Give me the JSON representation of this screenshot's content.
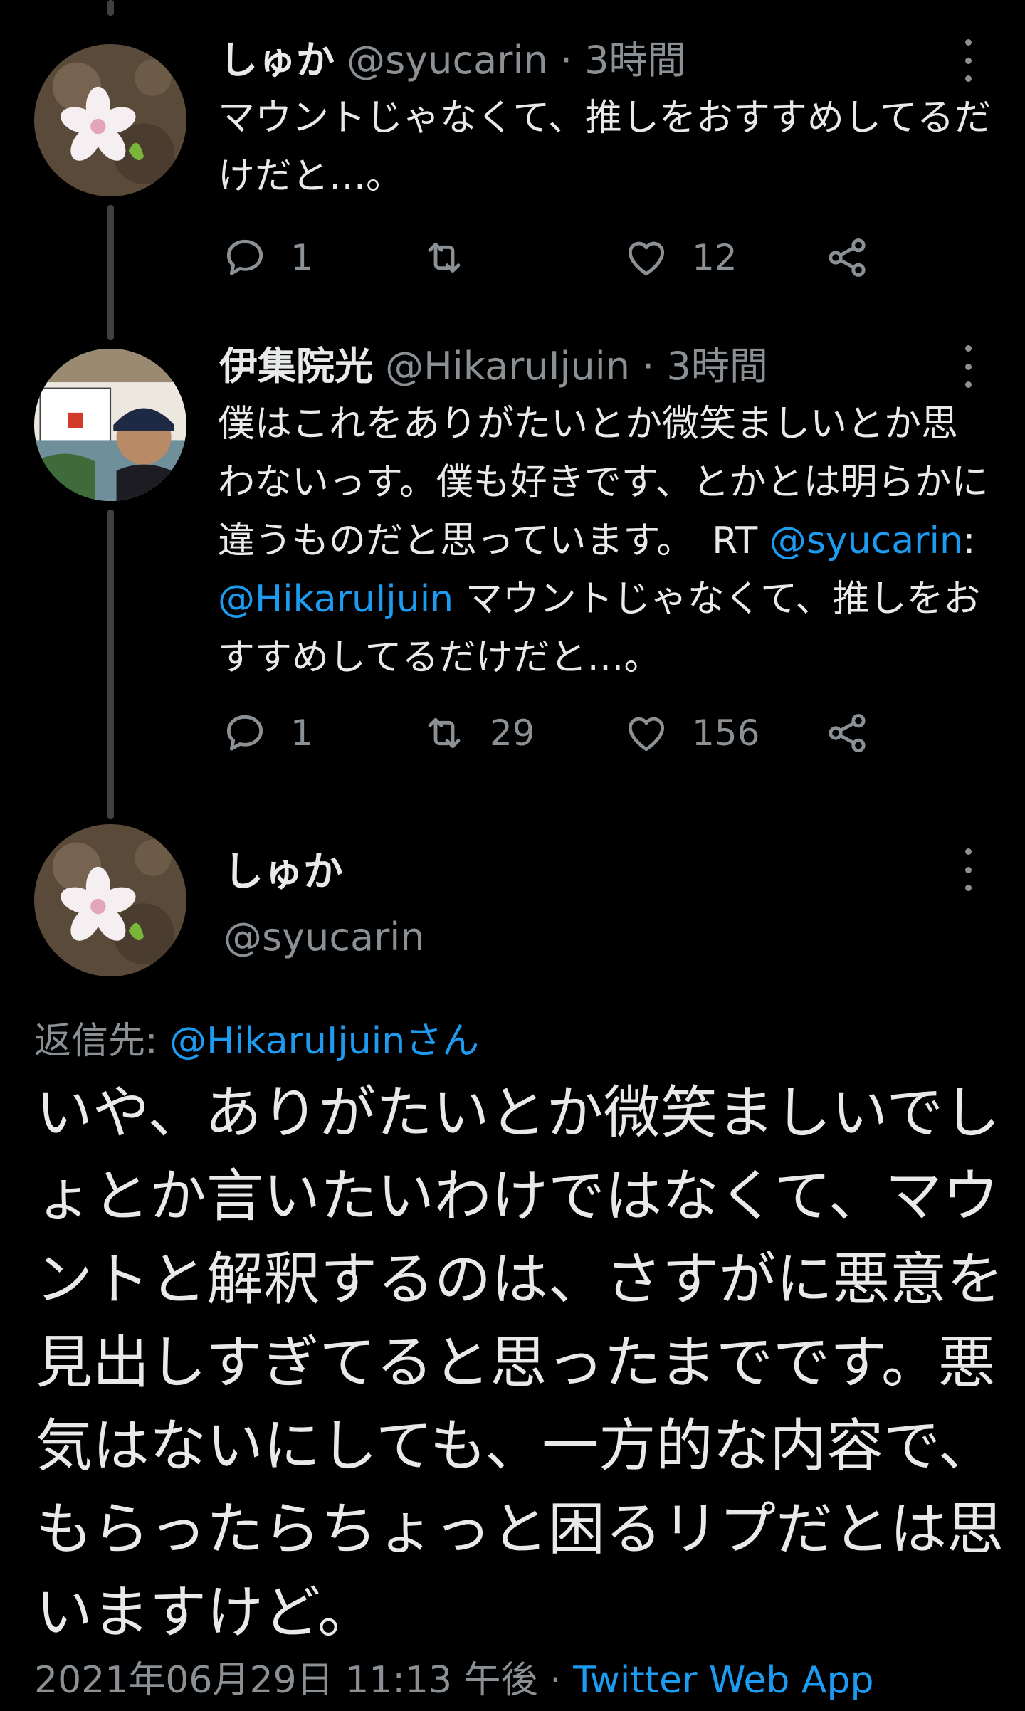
{
  "tweets": [
    {
      "name": "しゅか",
      "handle": "@syucarin",
      "time": "3時間",
      "text": "マウントじゃなくて、推しをおすすめしてるだけだと…。",
      "replies": "1",
      "retweets": "",
      "likes": "12"
    },
    {
      "name": "伊集院光",
      "handle": "@HikaruIjuin",
      "time": "3時間",
      "text_main": "僕はこれをありがたいとか微笑ましいとか思わないっす。僕も好きです、とかとは明らかに違うものだと思っています。　RT ",
      "mention1": "@syucarin",
      "colon": ": ",
      "mention2": "@HikaruIjuin",
      "text_tail": " マウントじゃなくて、推しをおすすめしてるだけだと…。",
      "replies": "1",
      "retweets": "29",
      "likes": "156"
    }
  ],
  "main_tweet": {
    "name": "しゅか",
    "handle": "@syucarin",
    "reply_label": "返信先: ",
    "reply_target": "@HikaruIjuinさん",
    "text": "いや、ありがたいとか微笑ましいでしょとか言いたいわけではなくて、マウントと解釈するのは、さすがに悪意を見出しすぎてると思ったまでです。悪気はないにしても、一方的な内容で、もらったらちょっと困るリプだとは思いますけど。",
    "timestamp": "2021年06月29日 11:13 午後",
    "separator": " · ",
    "source": "Twitter Web App"
  },
  "colors": {
    "background": "#000000",
    "text": "#e7e9ea",
    "muted": "#8b9095",
    "link": "#1d9bf0"
  },
  "icons": [
    "reply-icon",
    "retweet-icon",
    "like-icon",
    "share-icon",
    "more-icon"
  ]
}
